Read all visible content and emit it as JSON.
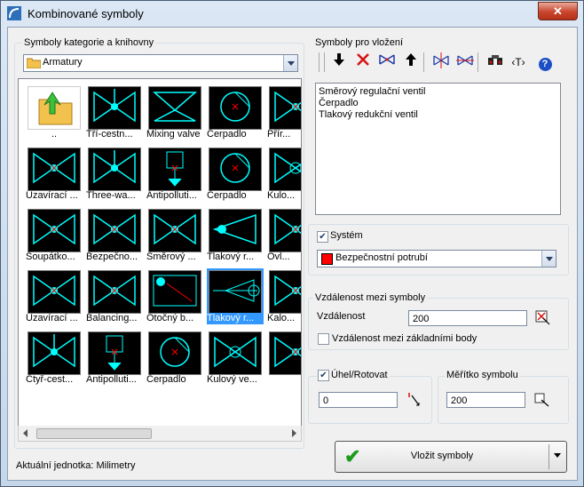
{
  "window": {
    "title": "Kombinované symboly",
    "close_glyph": "✕"
  },
  "library": {
    "group_label": "Symboly kategorie a knihovny",
    "category": "Armatury",
    "symbols": [
      {
        "label": "..",
        "icon": "folder-up-icon"
      },
      {
        "label": "Tří-cestn...",
        "icon": "three-way-valve-icon"
      },
      {
        "label": "Mixing valve",
        "icon": "mixing-valve-icon"
      },
      {
        "label": "Čerpadlo",
        "icon": "pump-icon"
      },
      {
        "label": "Přír...",
        "icon": "valve-icon"
      },
      {
        "label": "Uzavírací ...",
        "icon": "shutoff-valve-icon"
      },
      {
        "label": "Three-wa...",
        "icon": "three-way-valve-icon"
      },
      {
        "label": "Antipolluti...",
        "icon": "antipollution-valve-icon"
      },
      {
        "label": "Čerpadlo",
        "icon": "pump-icon"
      },
      {
        "label": "Kulo...",
        "icon": "ball-valve-icon"
      },
      {
        "label": "Šoupátko...",
        "icon": "gate-valve-icon"
      },
      {
        "label": "Bezpečno...",
        "icon": "safety-valve-icon"
      },
      {
        "label": "Směrový ...",
        "icon": "directional-valve-icon"
      },
      {
        "label": "Tlakový r...",
        "icon": "pressure-valve-icon"
      },
      {
        "label": "Ovl...",
        "icon": "control-valve-icon"
      },
      {
        "label": "Uzavírací ...",
        "icon": "shutoff-valve-icon"
      },
      {
        "label": "Balancing...",
        "icon": "balancing-valve-icon"
      },
      {
        "label": "Otočný b...",
        "icon": "rotary-valve-icon"
      },
      {
        "label": "Tlakový r...",
        "icon": "pressure-reducing-valve-icon"
      },
      {
        "label": "Kalo...",
        "icon": "valve-icon"
      },
      {
        "label": "Čtyř-cest...",
        "icon": "four-way-valve-icon"
      },
      {
        "label": "Antipolluti...",
        "icon": "antipollution-valve-icon"
      },
      {
        "label": "Čerpadlo",
        "icon": "pump-icon"
      },
      {
        "label": "Kulový ve...",
        "icon": "ball-valve-icon"
      },
      {
        "label": "",
        "icon": "valve-icon"
      }
    ],
    "selected_index": 18
  },
  "insert": {
    "group_label": "Symboly pro vložení",
    "toolbar": [
      "move-down-icon",
      "delete-icon",
      "flip-icon",
      "move-up-icon",
      "mirror-icon",
      "mirror-copy-icon",
      "find-icon",
      "text-icon",
      "help-icon"
    ],
    "text_glyph": "‹T›",
    "help_glyph": "?",
    "items": [
      "Směrový regulační ventil",
      "Čerpadlo",
      "Tlakový redukční ventil"
    ]
  },
  "system": {
    "label": "Systém",
    "checked": true,
    "value": "Bezpečnostní potrubí",
    "color": "#ff0000"
  },
  "distance": {
    "group_label": "Vzdálenost mezi symboly",
    "label": "Vzdálenost",
    "value": "200",
    "base_points_label": "Vzdálenost mezi základními body",
    "base_points_checked": false
  },
  "angle": {
    "label": "Úhel/Rotovat",
    "checked": true,
    "value": "0"
  },
  "scale": {
    "label": "Měřítko symbolu",
    "value": "200"
  },
  "button": {
    "label": "Vložit symboly",
    "check_glyph": "✔"
  },
  "status": {
    "text": "Aktuální jednotka: Milimetry"
  },
  "colors": {
    "symbol_line": "#00ffff",
    "symbol_accent": "#ff0000",
    "selection": "#3399ff"
  }
}
